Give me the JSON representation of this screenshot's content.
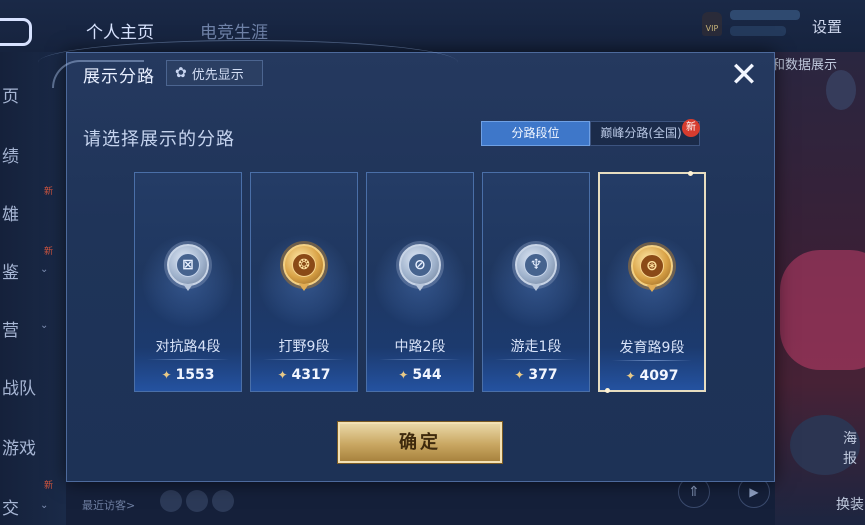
{
  "background": {
    "tabs": [
      "个人主页",
      "电竞生涯"
    ],
    "settings_label": "设置",
    "vip_label": "VIP",
    "side_items": [
      "页",
      "绩",
      "雄",
      "鉴",
      "营",
      "战队",
      "游戏",
      "交"
    ],
    "side_new": "新",
    "right_texts": [
      "和数据展示",
      "海报",
      "换装"
    ],
    "recent_visitors": "最近访客>"
  },
  "dialog": {
    "title": "展示分路",
    "pref_label": "优先显示",
    "close_icon": "close-icon",
    "prompt": "请选择展示的分路",
    "tabs": [
      {
        "label": "分路段位",
        "active": true
      },
      {
        "label": "巅峰分路(全国)",
        "active": false
      }
    ],
    "tab_new_badge": "新",
    "lanes": [
      {
        "rank": "对抗路4段",
        "score": "1553",
        "emblem": "silver",
        "symbol": "⊠",
        "selected": false
      },
      {
        "rank": "打野9段",
        "score": "4317",
        "emblem": "gold",
        "symbol": "❂",
        "selected": false
      },
      {
        "rank": "中路2段",
        "score": "544",
        "emblem": "silver",
        "symbol": "⊘",
        "selected": false
      },
      {
        "rank": "游走1段",
        "score": "377",
        "emblem": "silver",
        "symbol": "♆",
        "selected": false
      },
      {
        "rank": "发育路9段",
        "score": "4097",
        "emblem": "gold",
        "symbol": "⊛",
        "selected": true
      }
    ],
    "confirm_label": "确定"
  },
  "colors": {
    "accent_blue": "#3e77c9",
    "gold": "#c9a762",
    "silver": "#9fb2cc",
    "badge_red": "#d63c2f"
  }
}
